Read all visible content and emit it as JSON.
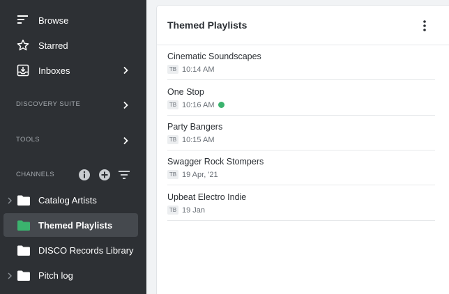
{
  "sidebar": {
    "nav": [
      {
        "label": "Browse",
        "icon": "browse-lines-icon"
      },
      {
        "label": "Starred",
        "icon": "star-icon"
      },
      {
        "label": "Inboxes",
        "icon": "inbox-icon"
      }
    ],
    "sections": {
      "discovery": "DISCOVERY SUITE",
      "tools": "TOOLS",
      "channels": "CHANNELS"
    },
    "channels": [
      {
        "label": "Catalog Artists",
        "expandable": true,
        "folder_color": "#ffffff"
      },
      {
        "label": "Themed Playlists",
        "expandable": false,
        "folder_color": "#3bb36e",
        "active": true
      },
      {
        "label": "DISCO Records Library",
        "expandable": false,
        "folder_color": "#ffffff"
      },
      {
        "label": "Pitch log",
        "expandable": true,
        "folder_color": "#ffffff"
      }
    ]
  },
  "panel": {
    "title": "Themed Playlists",
    "items": [
      {
        "name": "Cinematic Soundscapes",
        "initials": "TB",
        "time": "10:14 AM",
        "status_dot": false
      },
      {
        "name": "One Stop",
        "initials": "TB",
        "time": "10:16 AM",
        "status_dot": true
      },
      {
        "name": "Party Bangers",
        "initials": "TB",
        "time": "10:15 AM",
        "status_dot": false
      },
      {
        "name": "Swagger Rock Stompers",
        "initials": "TB",
        "time": "19 Apr, '21",
        "status_dot": false
      },
      {
        "name": "Upbeat Electro Indie",
        "initials": "TB",
        "time": "19 Jan",
        "status_dot": false
      }
    ]
  },
  "colors": {
    "sidebar_bg": "#2d3034",
    "active_bg": "#45494e",
    "accent_green": "#3bb36e"
  }
}
